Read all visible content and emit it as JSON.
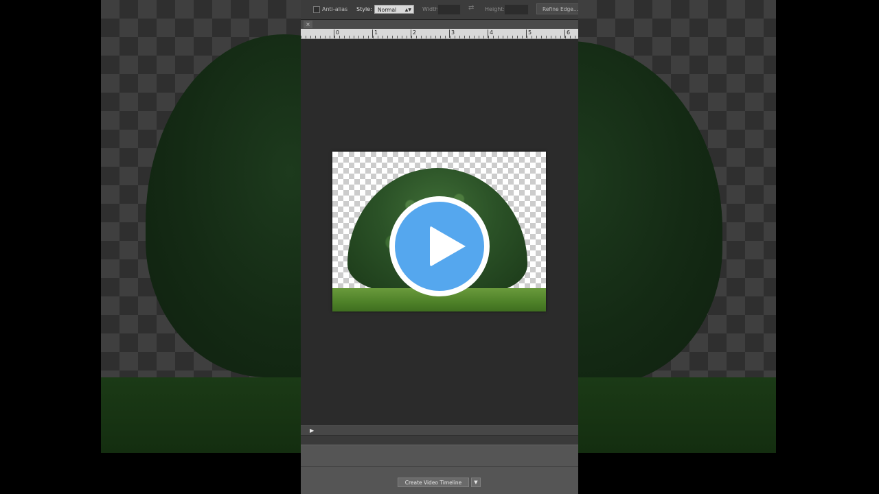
{
  "options_bar": {
    "anti_alias_label": "Anti-alias",
    "style_label": "Style:",
    "style_value": "Normal",
    "width_label": "Width:",
    "height_label": "Height:",
    "refine_edge_label": "Refine Edge..."
  },
  "document_tab": {
    "close_glyph": "×"
  },
  "ruler": {
    "marks": [
      "0",
      "1",
      "2",
      "3",
      "4",
      "5",
      "6"
    ]
  },
  "timeline": {
    "play_glyph": "▶",
    "create_video_timeline_label": "Create Video Timeline",
    "dropdown_glyph": "▼"
  },
  "colors": {
    "play_button_fill": "#55a7ee",
    "workspace_bg": "#2b2b2b"
  },
  "icons": {
    "play_overlay": "play-icon",
    "swap": "swap-arrows-icon"
  }
}
